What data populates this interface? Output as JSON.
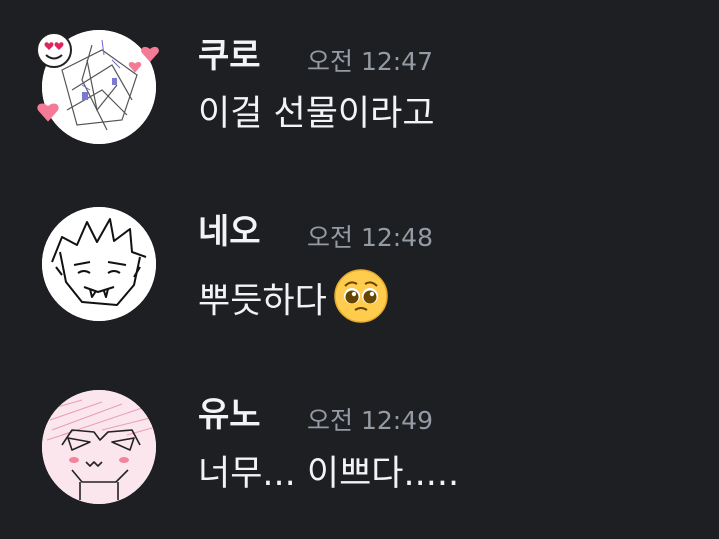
{
  "colors": {
    "background": "#1e1f22",
    "username": "#f2f3f5",
    "timestamp": "#949ba4",
    "message_text": "#f2f3f5"
  },
  "messages": [
    {
      "username": "쿠로",
      "timestamp": "오전 12:47",
      "text": "이걸 선물이라고",
      "avatar_icon": "kuro-avatar-with-heart-eyes-emoji-and-hearts"
    },
    {
      "username": "네오",
      "timestamp": "오전 12:48",
      "text": "뿌듯하다",
      "emoji": "pleading-face-icon",
      "avatar_icon": "neo-avatar-sketch"
    },
    {
      "username": "유노",
      "timestamp": "오전 12:49",
      "text": "너무... 이쁘다.....",
      "avatar_icon": "yuno-avatar-sketch-pink"
    }
  ]
}
